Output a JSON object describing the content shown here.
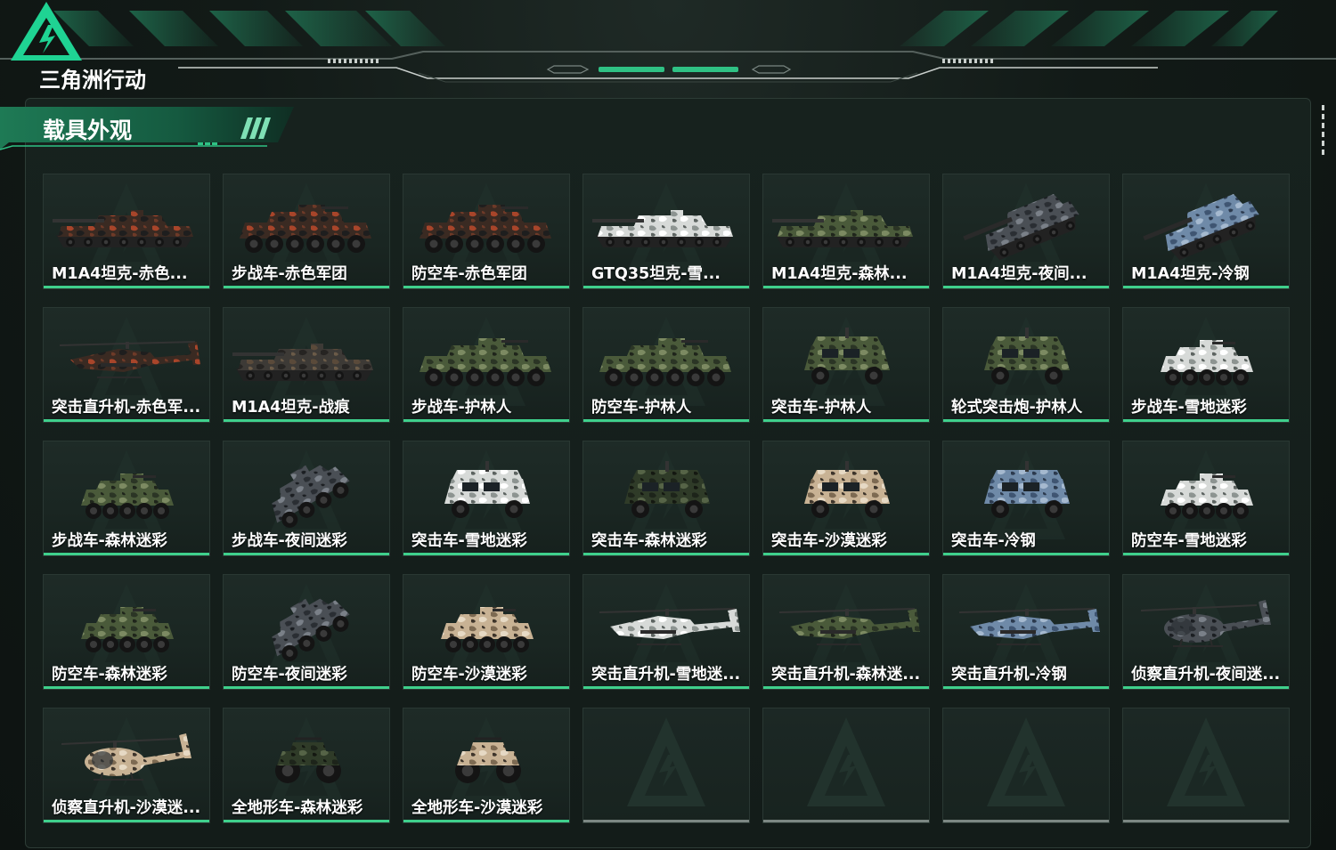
{
  "app": {
    "logo_text": "三角洲行动"
  },
  "section": {
    "title": "载具外观"
  },
  "colors": {
    "accent": "#3fd08c",
    "empty_bar": "#7c8783",
    "background": "#121a17"
  },
  "items": [
    {
      "label": "M1A4坦克-赤色...",
      "type": "tank",
      "camo": "red"
    },
    {
      "label": "步战车-赤色军团",
      "type": "ifv",
      "camo": "red"
    },
    {
      "label": "防空车-赤色军团",
      "type": "ifv",
      "camo": "red"
    },
    {
      "label": "GTQ35坦克-雪...",
      "type": "tank",
      "camo": "snow"
    },
    {
      "label": "M1A4坦克-森林...",
      "type": "tank",
      "camo": "forest"
    },
    {
      "label": "M1A4坦克-夜间...",
      "type": "tank-angled",
      "camo": "night"
    },
    {
      "label": "M1A4坦克-冷钢",
      "type": "tank-angled",
      "camo": "steel"
    },
    {
      "label": "突击直升机-赤色军...",
      "type": "heli",
      "camo": "red"
    },
    {
      "label": "M1A4坦克-战痕",
      "type": "tank",
      "camo": "dark"
    },
    {
      "label": "步战车-护林人",
      "type": "ifv",
      "camo": "forest"
    },
    {
      "label": "防空车-护林人",
      "type": "ifv",
      "camo": "forest"
    },
    {
      "label": "突击车-护林人",
      "type": "truck",
      "camo": "forest"
    },
    {
      "label": "轮式突击炮-护林人",
      "type": "truck",
      "camo": "forest"
    },
    {
      "label": "步战车-雪地迷彩",
      "type": "ifv-small",
      "camo": "snow"
    },
    {
      "label": "步战车-森林迷彩",
      "type": "ifv-small",
      "camo": "forest"
    },
    {
      "label": "步战车-夜间迷彩",
      "type": "ifv-angled",
      "camo": "night"
    },
    {
      "label": "突击车-雪地迷彩",
      "type": "truck",
      "camo": "snow"
    },
    {
      "label": "突击车-森林迷彩",
      "type": "truck",
      "camo": "forestdark"
    },
    {
      "label": "突击车-沙漠迷彩",
      "type": "truck",
      "camo": "desert"
    },
    {
      "label": "突击车-冷钢",
      "type": "truck",
      "camo": "steel"
    },
    {
      "label": "防空车-雪地迷彩",
      "type": "ifv-small",
      "camo": "snow"
    },
    {
      "label": "防空车-森林迷彩",
      "type": "ifv-small",
      "camo": "forest"
    },
    {
      "label": "防空车-夜间迷彩",
      "type": "ifv-angled",
      "camo": "night"
    },
    {
      "label": "防空车-沙漠迷彩",
      "type": "ifv-small",
      "camo": "desert"
    },
    {
      "label": "突击直升机-雪地迷...",
      "type": "heli",
      "camo": "snow"
    },
    {
      "label": "突击直升机-森林迷...",
      "type": "heli",
      "camo": "forest"
    },
    {
      "label": "突击直升机-冷钢",
      "type": "heli",
      "camo": "steel"
    },
    {
      "label": "侦察直升机-夜间迷...",
      "type": "scout-heli",
      "camo": "night"
    },
    {
      "label": "侦察直升机-沙漠迷...",
      "type": "scout-heli",
      "camo": "desert"
    },
    {
      "label": "全地形车-森林迷彩",
      "type": "atv",
      "camo": "forestdark"
    },
    {
      "label": "全地形车-沙漠迷彩",
      "type": "atv",
      "camo": "desert"
    },
    {
      "label": "",
      "type": "empty",
      "camo": ""
    },
    {
      "label": "",
      "type": "empty",
      "camo": ""
    },
    {
      "label": "",
      "type": "empty",
      "camo": ""
    },
    {
      "label": "",
      "type": "empty",
      "camo": ""
    }
  ]
}
